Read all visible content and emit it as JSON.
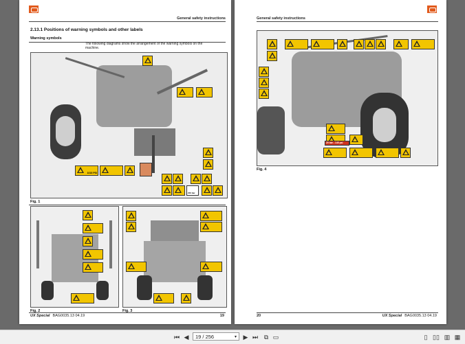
{
  "left_page": {
    "header": "General safety instructions",
    "section_title": "2.13.1    Positions of warning symbols and other labels",
    "subheading": "Warning symbols",
    "paragraph": "The following diagrams show the arrangement of the warning symbols on the machine.",
    "fig1_caption": "Fig. 1",
    "fig2_caption": "Fig. 2",
    "fig3_caption": "Fig. 3",
    "label_psi": "1015 PSI",
    "label_bar": "210 bar",
    "footer_brand": "UX Special",
    "footer_doc": "BAG0035.13  04.19",
    "page_number": "19"
  },
  "right_page": {
    "header": "General safety instructions",
    "fig4_caption": "Fig. 4",
    "label_red": "20 bar - 145 psi",
    "footer_page_number": "20",
    "footer_brand": "UX Special",
    "footer_doc": "BAG0035.13  04.19"
  },
  "toolbar": {
    "first_page": "⏮",
    "prev_page": "◀",
    "page_indicator": "19 / 256",
    "dropdown": "▾",
    "next_page": "▶",
    "last_page": "⏭",
    "extra1": "⧉",
    "extra2": "▭",
    "view1": "▯",
    "view2": "▯▯",
    "view3": "▥",
    "view4": "▦"
  },
  "colors": {
    "warning_yellow": "#f2c500",
    "brand_orange": "#e15a1c",
    "viewer_bg": "#6a6a6a"
  }
}
